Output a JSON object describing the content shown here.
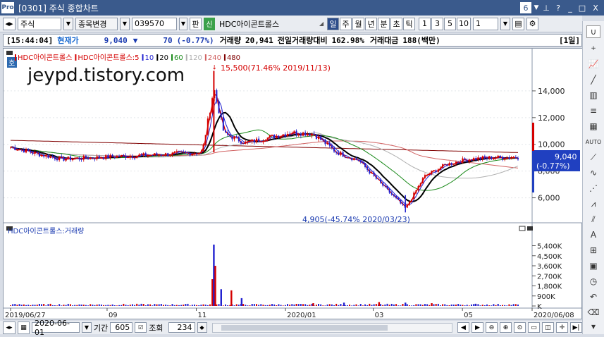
{
  "window": {
    "logo": "Pro",
    "title": "[0301] 주식 종합차트",
    "page_num": "6",
    "pin_icon": "pin-icon",
    "help_label": "?",
    "min_label": "_",
    "max_label": "□",
    "close_label": "X"
  },
  "toolbar": {
    "market": "주식",
    "stock_change_label": "종목변경",
    "code": "039570",
    "pan_label": "판",
    "shin_label": "신",
    "stock_name": "HDC아이콘트롤스",
    "periods": [
      "일",
      "주",
      "월",
      "년",
      "분",
      "초",
      "틱"
    ],
    "active_period": "일",
    "intervals": [
      "1",
      "3",
      "5",
      "10"
    ],
    "interval_value": "1"
  },
  "info": {
    "time": "[15:44:04]",
    "price_label": "현재가",
    "price": "9,040",
    "change_arrow": "▼",
    "change": "70",
    "change_pct": "(-0.77%)",
    "volume_label": "거래량",
    "volume": "20,941",
    "prev_volume_label": "전일거래량대비",
    "prev_volume_pct": "162.98%",
    "trade_amount_label": "거래대금",
    "trade_amount": "188(백만)",
    "period_tag": "[1일]"
  },
  "price_panel": {
    "legend": [
      {
        "label": "HDC아이콘트롤스",
        "color": "#d40000"
      },
      {
        "label": "HDC아이콘트롤스:5",
        "color": "#d40000"
      },
      {
        "label": "10",
        "color": "#2020d0"
      },
      {
        "label": "20",
        "color": "#000000"
      },
      {
        "label": "60",
        "color": "#1a8a1a"
      },
      {
        "label": "120",
        "color": "#b0b0b0"
      },
      {
        "label": "240",
        "color": "#d06060"
      },
      {
        "label": "480",
        "color": "#800000"
      }
    ],
    "ho_label": "호",
    "watermark": "jeypd.tistory.com",
    "high_annotation": "15,500(71.46% 2019/11/13)",
    "low_annotation": "4,905(-45.74% 2020/03/23)",
    "current_price_tag": "9,040",
    "current_pct_tag": "(-0.77%)"
  },
  "volume_panel": {
    "legend": "HDC아이콘트롤스:거래량"
  },
  "bottom": {
    "date": "2020-06-01",
    "period_label": "기간",
    "period_value": "605",
    "query_label": "조회",
    "query_value": "234"
  },
  "chart_data": [
    {
      "type": "line",
      "series": [
        {
          "name": "HDC아이콘트롤스",
          "kind": "candlestick-close",
          "x": [
            "2019/06/27",
            "2019/07/15",
            "2019/08/01",
            "2019/08/20",
            "2019/09/10",
            "2019/10/01",
            "2019/10/20",
            "2019/11/05",
            "2019/11/13",
            "2019/11/20",
            "2019/12/05",
            "2019/12/20",
            "2020/01/05",
            "2020/01/20",
            "2020/02/05",
            "2020/02/20",
            "2020/03/05",
            "2020/03/23",
            "2020/04/05",
            "2020/04/20",
            "2020/05/05",
            "2020/05/20",
            "2020/06/08"
          ],
          "values": [
            9800,
            9300,
            8900,
            9000,
            9100,
            9200,
            9300,
            9400,
            14200,
            10800,
            10100,
            10500,
            10900,
            10800,
            9400,
            8800,
            7200,
            5200,
            7600,
            8500,
            8900,
            9000,
            9040
          ]
        },
        {
          "name": "20",
          "values": [
            9700,
            9400,
            9100,
            9050,
            9100,
            9200,
            9300,
            9400,
            10000,
            10600,
            10300,
            10400,
            10700,
            10900,
            10000,
            9300,
            8200,
            6900,
            6300,
            7200,
            8200,
            8700,
            9000
          ]
        }
      ],
      "xticks": [
        "2019/06/27",
        "09",
        "11",
        "2020/01",
        "03",
        "05",
        "2020/06/08"
      ],
      "yticks": [
        "6,000",
        "8,000",
        "10,000",
        "12,000",
        "14,000"
      ],
      "ylim": [
        4500,
        16000
      ],
      "high": {
        "value": 15500,
        "date": "2019/11/13"
      },
      "low": {
        "value": 4905,
        "date": "2020/03/23"
      }
    },
    {
      "type": "bar",
      "series": [
        {
          "name": "HDC아이콘트롤스:거래량",
          "x": [
            "2019/11/12",
            "2019/11/13",
            "2019/11/14",
            "2019/11/18",
            "2019/11/25",
            "2019/12/02",
            "2020/01/20",
            "2020/02/10",
            "2020/03/05",
            "2020/03/23",
            "2020/04/10",
            "2020/05/10"
          ],
          "values": [
            2400000,
            5500000,
            3600000,
            1500000,
            1400000,
            700000,
            250000,
            300000,
            350000,
            300000,
            250000,
            200000
          ]
        }
      ],
      "yticks": [
        "K",
        "900K",
        "1,800K",
        "2,700K",
        "3,600K",
        "4,500K",
        "5,400K"
      ],
      "ylim": [
        0,
        6000000
      ]
    }
  ]
}
